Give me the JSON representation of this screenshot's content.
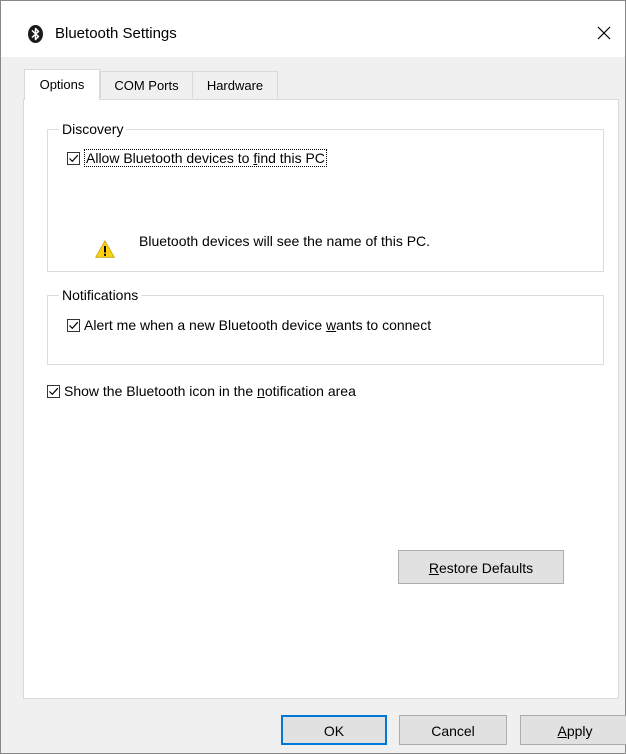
{
  "window": {
    "title": "Bluetooth Settings",
    "close_glyph": "✕"
  },
  "tabs": [
    {
      "label": "Options",
      "active": true
    },
    {
      "label": "COM Ports",
      "active": false
    },
    {
      "label": "Hardware",
      "active": false
    }
  ],
  "discovery": {
    "group_label": "Discovery",
    "allow_find": {
      "label_pre": "Allow Bluetooth devices to ",
      "label_key": "f",
      "label_post": "ind this PC",
      "checked": true
    },
    "warning_text": "Bluetooth devices will see the name of this PC."
  },
  "notifications": {
    "group_label": "Notifications",
    "alert_connect": {
      "label_pre": "Alert me when a new Bluetooth device ",
      "label_key": "w",
      "label_post": "ants to connect",
      "checked": true
    }
  },
  "show_icon": {
    "label_pre": "Show the Bluetooth icon in the ",
    "label_key": "n",
    "label_post": "otification area",
    "checked": true
  },
  "buttons": {
    "restore": {
      "key": "R",
      "rest": "estore Defaults"
    },
    "ok": "OK",
    "cancel": "Cancel",
    "apply": {
      "key": "A",
      "rest": "pply"
    }
  },
  "icons": {
    "app": "bluetooth-icon",
    "warning": "warning-icon",
    "check": "checkmark-icon",
    "close": "close-icon"
  },
  "colors": {
    "window_bg": "#f0f0f0",
    "panel_bg": "#ffffff",
    "default_button_border": "#0078d7",
    "warning_yellow": "#fcd116"
  }
}
